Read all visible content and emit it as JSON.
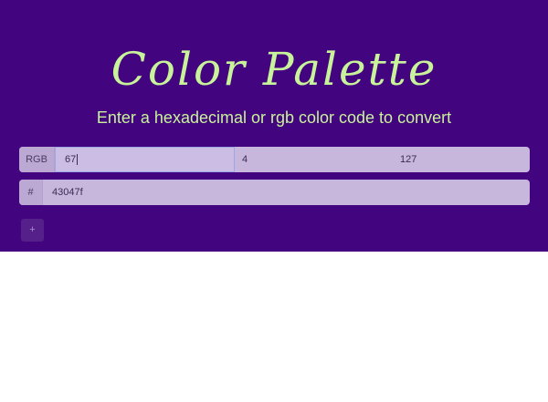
{
  "header": {
    "title": "Color Palette",
    "subtitle": "Enter a hexadecimal or rgb color code to convert"
  },
  "rgb_row": {
    "prefix": "RGB",
    "r_value": "67",
    "g_value": "4",
    "b_value": "127"
  },
  "hex_row": {
    "prefix": "#",
    "value": "43047f"
  },
  "add_button": {
    "label": "+"
  },
  "colors": {
    "background": "#43047f",
    "accent": "#c8f39a"
  }
}
